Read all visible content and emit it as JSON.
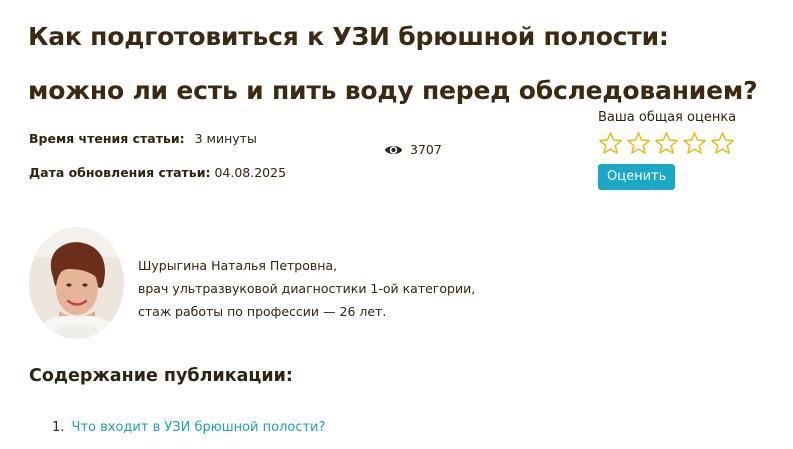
{
  "article": {
    "title": "Как подготовиться к УЗИ брюшной полости: можно ли есть и пить воду перед обследованием?",
    "reading_time_label": "Время чтения статьи:",
    "reading_time_value": "3 минуты",
    "updated_label": "Дата обновления статьи:",
    "updated_value": "04.08.2025",
    "views": "3707"
  },
  "rating": {
    "label": "Ваша общая оценка",
    "max_stars": 5,
    "selected": 0,
    "button_label": "Оценить",
    "accent_color": "#19a9c6",
    "star_color": "#e8b400"
  },
  "author": {
    "name": "Шурыгина Наталья Петровна,",
    "position": "врач ультразвуковой диагностики 1-ой категории,",
    "experience": "стаж работы по профессии — 26 лет."
  },
  "toc": {
    "title": "Содержание публикации:",
    "items": [
      {
        "number": "1.",
        "text": "Что входит в УЗИ брюшной полости?"
      }
    ]
  },
  "icons": {
    "views": "eye-icon",
    "star": "star-outline-icon"
  }
}
